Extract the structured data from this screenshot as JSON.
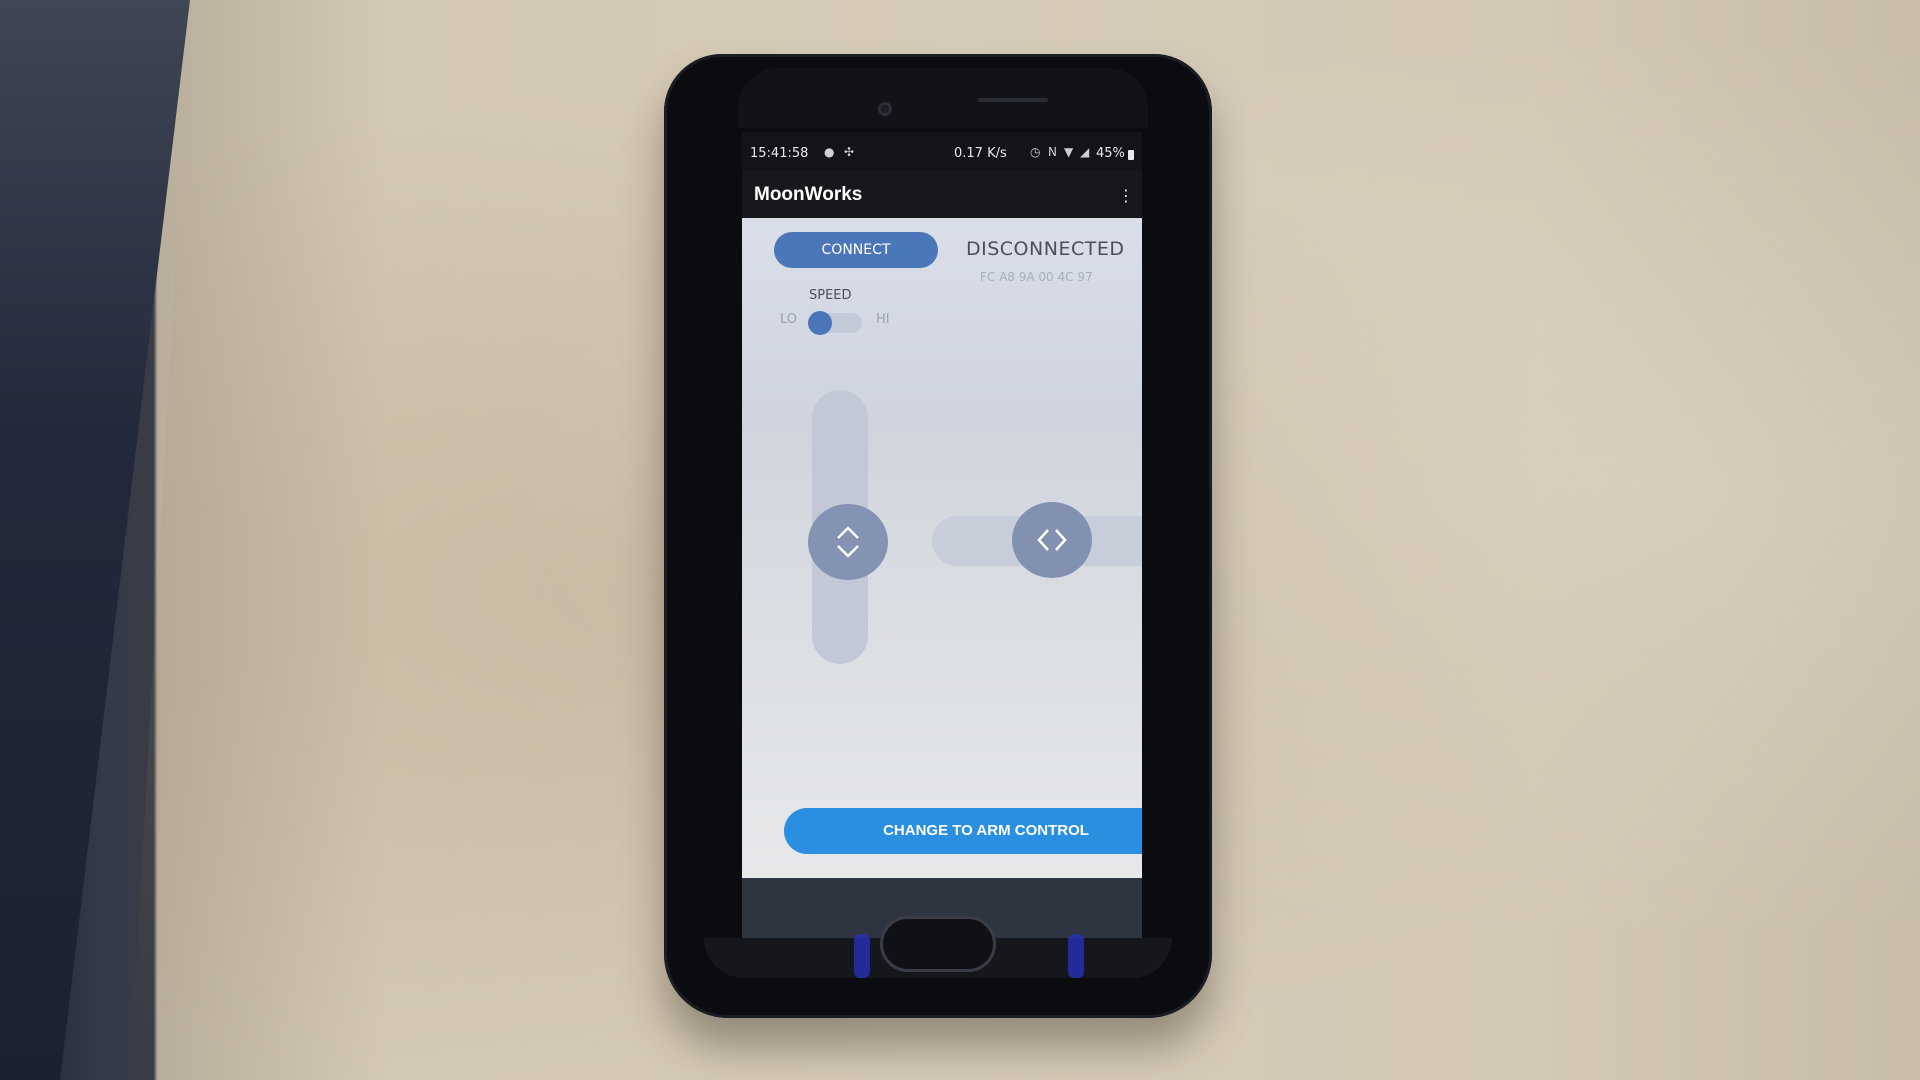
{
  "status_bar": {
    "time": "15:41:58",
    "net_speed": "0.17 K/s",
    "battery": "45%"
  },
  "app_bar": {
    "title": "MoonWorks",
    "overflow_icon": "⋮"
  },
  "connection": {
    "connect_label": "CONNECT",
    "status": "DISCONNECTED",
    "mac_address": "FC A8 9A 00 4C 97"
  },
  "speed_toggle": {
    "label": "SPEED",
    "lo_label": "LO",
    "hi_label": "HI",
    "value": "LO"
  },
  "controls": {
    "vertical_icon": "up-down-chevrons",
    "horizontal_icon": "left-right-chevrons"
  },
  "arm_button": {
    "label": "CHANGE TO ARM CONTROL"
  },
  "colors": {
    "primary": "#2a8fe0",
    "connect": "#4b76b9",
    "knob": "#8493b2"
  }
}
